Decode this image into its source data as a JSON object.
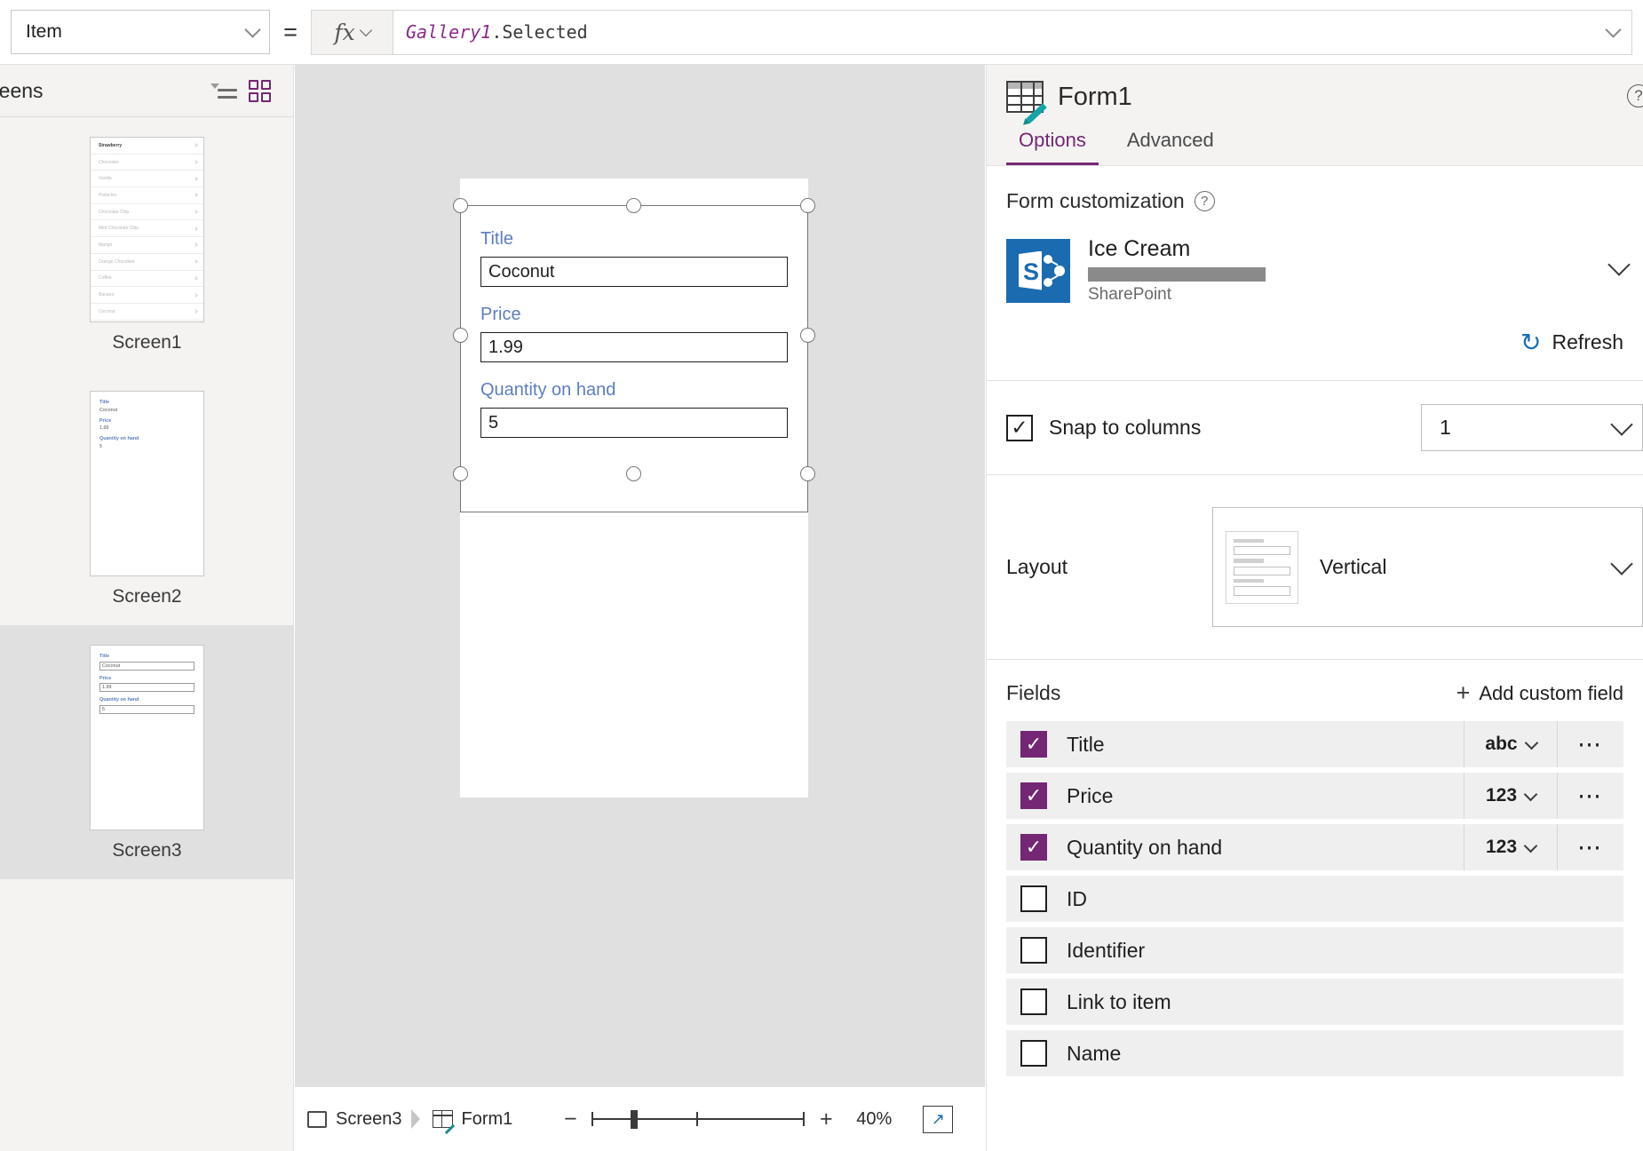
{
  "topbar": {
    "property_label": "Item",
    "equals": "=",
    "fx_label": "fx",
    "formula_object": "Gallery1",
    "formula_property": ".Selected"
  },
  "left_panel": {
    "title": "reens",
    "icons": {
      "treeview": "tree-view-icon",
      "gridview": "grid-view-icon"
    },
    "screens": [
      {
        "label": "Screen1",
        "type": "gallery",
        "items": [
          "Strawberry",
          "Chocolate",
          "Vanilla",
          "Pistachio",
          "Chocolate Chip",
          "Mint Chocolate Chip",
          "Mango",
          "Orange Chocolate",
          "Coffee",
          "Banana",
          "Coconut"
        ]
      },
      {
        "label": "Screen2",
        "type": "display-form",
        "fields": [
          {
            "label": "Title",
            "value": "Coconut"
          },
          {
            "label": "Price",
            "value": "1.99"
          },
          {
            "label": "Quantity on hand",
            "value": "5"
          }
        ]
      },
      {
        "label": "Screen3",
        "type": "edit-form",
        "selected": true,
        "fields": [
          {
            "label": "Title",
            "value": "Coconut"
          },
          {
            "label": "Price",
            "value": "1.99"
          },
          {
            "label": "Quantity on hand",
            "value": "5"
          }
        ]
      }
    ]
  },
  "canvas": {
    "form_fields": [
      {
        "label": "Title",
        "value": "Coconut"
      },
      {
        "label": "Price",
        "value": "1.99"
      },
      {
        "label": "Quantity on hand",
        "value": "5"
      }
    ]
  },
  "statusbar": {
    "breadcrumb": [
      {
        "label": "Screen3",
        "icon": "screen-icon"
      },
      {
        "label": "Form1",
        "icon": "form-icon"
      }
    ],
    "zoom_out": "−",
    "zoom_in": "+",
    "zoom_value": "40%",
    "fit_icon": "fit-to-screen-icon"
  },
  "right_panel": {
    "title": "Form1",
    "help_icon": "?",
    "tabs": [
      {
        "label": "Options",
        "active": true
      },
      {
        "label": "Advanced",
        "active": false
      }
    ],
    "form_customization": {
      "title": "Form customization",
      "help": "?",
      "datasource_name": "Ice Cream",
      "datasource_type": "SharePoint",
      "datasource_icon": "sharepoint-icon",
      "refresh_label": "Refresh",
      "refresh_icon": "refresh-icon"
    },
    "snap_to_columns": {
      "label": "Snap to columns",
      "checked": true,
      "columns_value": "1"
    },
    "layout": {
      "label": "Layout",
      "value": "Vertical"
    },
    "fields_section": {
      "title": "Fields",
      "add_label": "Add custom field",
      "rows": [
        {
          "name": "Title",
          "checked": true,
          "type": "abc"
        },
        {
          "name": "Price",
          "checked": true,
          "type": "123"
        },
        {
          "name": "Quantity on hand",
          "checked": true,
          "type": "123"
        },
        {
          "name": "ID",
          "checked": false,
          "type": ""
        },
        {
          "name": "Identifier",
          "checked": false,
          "type": ""
        },
        {
          "name": "Link to item",
          "checked": false,
          "type": ""
        },
        {
          "name": "Name",
          "checked": false,
          "type": ""
        }
      ]
    }
  },
  "colors": {
    "accent_purple": "#742774",
    "form_label_blue": "#5b7ec0",
    "sharepoint_blue": "#1b6bb0",
    "link_blue": "#1a6fb5",
    "teal": "#13a5a5"
  }
}
